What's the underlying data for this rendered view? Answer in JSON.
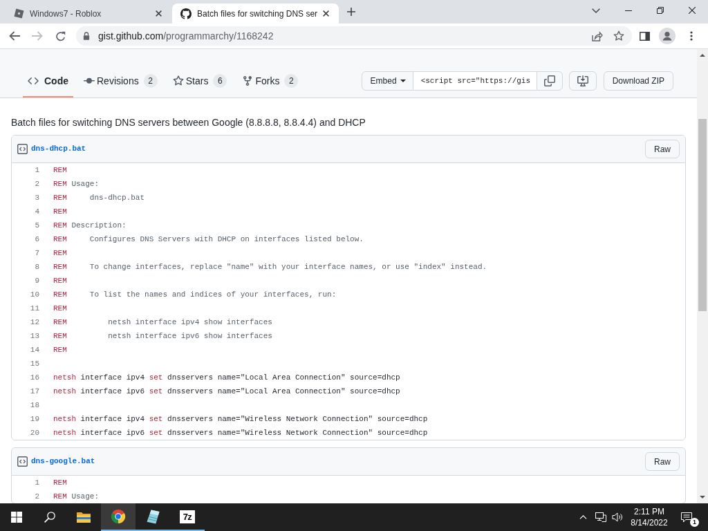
{
  "browser": {
    "tabs": [
      {
        "title": "Windows7 - Roblox",
        "selected": false
      },
      {
        "title": "Batch files for switching DNS ser",
        "selected": true
      }
    ],
    "back_disabled": false,
    "forward_disabled": true,
    "url": {
      "host": "gist.github.com",
      "path": "/programmarchy/1168242"
    }
  },
  "gist_nav": {
    "tabs": [
      {
        "kind": "code",
        "label": "Code",
        "selected": true
      },
      {
        "kind": "revisions",
        "label": "Revisions",
        "count": "2",
        "selected": false
      },
      {
        "kind": "stars",
        "label": "Stars",
        "count": "6",
        "selected": false
      },
      {
        "kind": "forks",
        "label": "Forks",
        "count": "2",
        "selected": false
      }
    ],
    "embed": {
      "label": "Embed",
      "value": "<script src=\"https://gis"
    },
    "download_button": "Download ZIP"
  },
  "description": "Batch files for switching DNS servers between Google (8.8.8.8, 8.8.4.4) and DHCP",
  "files": [
    {
      "name": "dns-dhcp.bat",
      "button": "Raw",
      "lines": [
        {
          "number": "1",
          "tokens": [
            {
              "kind": "keyword",
              "text": "REM"
            }
          ]
        },
        {
          "number": "2",
          "tokens": [
            {
              "kind": "keyword",
              "text": "REM"
            },
            {
              "kind": "comment",
              "text": " Usage:"
            }
          ]
        },
        {
          "number": "3",
          "tokens": [
            {
              "kind": "keyword",
              "text": "REM"
            },
            {
              "kind": "comment",
              "text": "     dns-dhcp.bat"
            }
          ]
        },
        {
          "number": "4",
          "tokens": [
            {
              "kind": "keyword",
              "text": "REM"
            }
          ]
        },
        {
          "number": "5",
          "tokens": [
            {
              "kind": "keyword",
              "text": "REM"
            },
            {
              "kind": "comment",
              "text": " Description:"
            }
          ]
        },
        {
          "number": "6",
          "tokens": [
            {
              "kind": "keyword",
              "text": "REM"
            },
            {
              "kind": "comment",
              "text": "     Configures DNS Servers with DHCP on interfaces listed below."
            }
          ]
        },
        {
          "number": "7",
          "tokens": [
            {
              "kind": "keyword",
              "text": "REM"
            }
          ]
        },
        {
          "number": "8",
          "tokens": [
            {
              "kind": "keyword",
              "text": "REM"
            },
            {
              "kind": "comment",
              "text": "     To change interfaces, replace \"name\" with your interface names, or use \"index\" instead."
            }
          ]
        },
        {
          "number": "9",
          "tokens": [
            {
              "kind": "keyword",
              "text": "REM"
            }
          ]
        },
        {
          "number": "10",
          "tokens": [
            {
              "kind": "keyword",
              "text": "REM"
            },
            {
              "kind": "comment",
              "text": "     To list the names and indices of your interfaces, run:"
            }
          ]
        },
        {
          "number": "11",
          "tokens": [
            {
              "kind": "keyword",
              "text": "REM"
            }
          ]
        },
        {
          "number": "12",
          "tokens": [
            {
              "kind": "keyword",
              "text": "REM"
            },
            {
              "kind": "comment",
              "text": "         netsh interface ipv4 show interfaces"
            }
          ]
        },
        {
          "number": "13",
          "tokens": [
            {
              "kind": "keyword",
              "text": "REM"
            },
            {
              "kind": "comment",
              "text": "         netsh interface ipv6 show interfaces"
            }
          ]
        },
        {
          "number": "14",
          "tokens": [
            {
              "kind": "keyword",
              "text": "REM"
            }
          ]
        },
        {
          "number": "15"
        },
        {
          "number": "16",
          "tokens": [
            {
              "kind": "keyword",
              "text": "netsh"
            },
            {
              "kind": "plain",
              "text": " interface ipv4 "
            },
            {
              "kind": "keyword",
              "text": "set"
            },
            {
              "kind": "plain",
              "text": " dnsservers name=\"Local Area Connection\" source=dhcp"
            }
          ]
        },
        {
          "number": "17",
          "tokens": [
            {
              "kind": "keyword",
              "text": "netsh"
            },
            {
              "kind": "plain",
              "text": " interface ipv6 "
            },
            {
              "kind": "keyword",
              "text": "set"
            },
            {
              "kind": "plain",
              "text": " dnsservers name=\"Local Area Connection\" source=dhcp"
            }
          ]
        },
        {
          "number": "18"
        },
        {
          "number": "19",
          "tokens": [
            {
              "kind": "keyword",
              "text": "netsh"
            },
            {
              "kind": "plain",
              "text": " interface ipv4 "
            },
            {
              "kind": "keyword",
              "text": "set"
            },
            {
              "kind": "plain",
              "text": " dnsservers name=\"Wireless Network Connection\" source=dhcp"
            }
          ]
        },
        {
          "number": "20",
          "tokens": [
            {
              "kind": "keyword",
              "text": "netsh"
            },
            {
              "kind": "plain",
              "text": " interface ipv6 "
            },
            {
              "kind": "keyword",
              "text": "set"
            },
            {
              "kind": "plain",
              "text": " dnsservers name=\"Wireless Network Connection\" source=dhcp"
            }
          ]
        }
      ]
    },
    {
      "name": "dns-google.bat",
      "button": "Raw",
      "lines": [
        {
          "number": "1",
          "tokens": [
            {
              "kind": "keyword",
              "text": "REM"
            }
          ]
        },
        {
          "number": "2",
          "tokens": [
            {
              "kind": "keyword",
              "text": "REM"
            },
            {
              "kind": "comment",
              "text": " Usage:"
            }
          ]
        }
      ]
    }
  ],
  "taskbar": {
    "apps": [
      {
        "kind": "file-explorer",
        "running": false,
        "selected": false
      },
      {
        "kind": "browser",
        "running": true,
        "selected": true
      },
      {
        "kind": "notes",
        "running": true,
        "selected": false
      },
      {
        "kind": "archiver",
        "label": "7z",
        "running": true,
        "selected": false
      }
    ],
    "time": "2:11 PM",
    "date": "8/14/2022",
    "notification_count": "1"
  }
}
